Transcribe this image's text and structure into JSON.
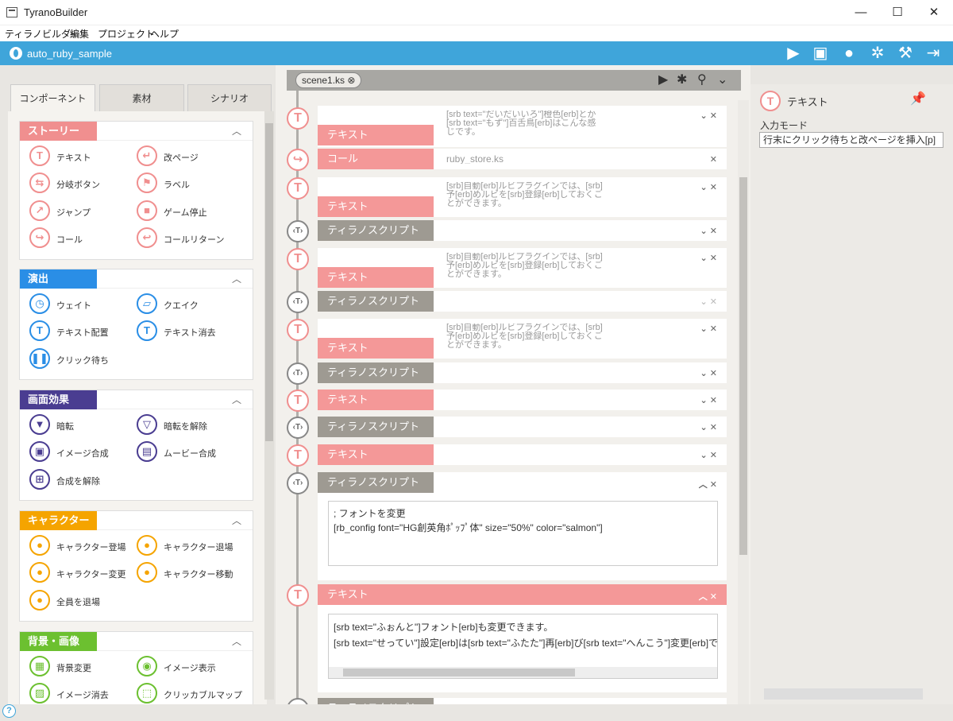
{
  "window": {
    "title": "TyranoBuilder",
    "minimize": "—",
    "maximize": "☐",
    "close": "✕"
  },
  "menu": [
    "ティラノビルダー",
    "編集",
    "プロジェクト",
    "ヘルプ"
  ],
  "project": {
    "name": "auto_ruby_sample"
  },
  "toolbar": {
    "icons": [
      "play-icon",
      "save-icon",
      "users-icon",
      "settings-icon",
      "build-icon",
      "exit-icon"
    ]
  },
  "left_tabs": [
    "コンポーネント",
    "素材",
    "シナリオ"
  ],
  "sections": [
    {
      "label": "ストーリー",
      "color": "#f08f8f",
      "items": [
        "テキスト",
        "改ページ",
        "分岐ボタン",
        "ラベル",
        "ジャンプ",
        "ゲーム停止",
        "コール",
        "コールリターン"
      ]
    },
    {
      "label": "演出",
      "color": "#2a8ee6",
      "items": [
        "ウェイト",
        "クエイク",
        "テキスト配置",
        "テキスト消去",
        "クリック待ち"
      ]
    },
    {
      "label": "画面効果",
      "color": "#4a3d91",
      "items": [
        "暗転",
        "暗転を解除",
        "イメージ合成",
        "ムービー合成",
        "合成を解除"
      ]
    },
    {
      "label": "キャラクター",
      "color": "#f5a400",
      "items": [
        "キャラクター登場",
        "キャラクター退場",
        "キャラクター変更",
        "キャラクター移動",
        "全員を退場"
      ]
    },
    {
      "label": "背景・画像",
      "color": "#6cc030",
      "items": [
        "背景変更",
        "イメージ表示",
        "イメージ消去",
        "クリッカブルマップ"
      ]
    }
  ],
  "scene_tab": {
    "label": "scene1.ks",
    "close": "⊗"
  },
  "node_glyph": {
    "text": "T",
    "call": "↪",
    "script": "‹T›"
  },
  "timeline": {
    "text_label": "テキスト",
    "call_label": "コール",
    "script_label": "ティラノスクリプト",
    "previews": {
      "p1": "[srb text=\"だいだいいろ\"]橙色[erb]とか\n[srb text=\"もず\"]百舌鳥[erb]はこんな感\nじです。",
      "call": "ruby_store.ks",
      "p2": "[srb]自動[erb]ルビプラグインでは、[srb]\n予[erb]めルビを[srb]登録[erb]しておくこ\nとができます。"
    },
    "script_editor": [
      "; フォントを変更",
      "[rb_config font=\"HG創英角ﾎﾟｯﾌﾟ体\" size=\"50%\" color=\"salmon\"]"
    ],
    "text_editor": [
      "[srb text=\"ふぉんと\"]フォント[erb]も変更できます。",
      "[srb text=\"せってい\"]設定[erb]は[srb text=\"ふたた\"]再[erb]び[srb text=\"へんこう\"]変更[erb]で"
    ]
  },
  "right_panel": {
    "title": "テキスト",
    "mode_label": "入力モード",
    "mode_value": "行末にクリック待ちと改ページを挿入[p]"
  },
  "help": "?"
}
